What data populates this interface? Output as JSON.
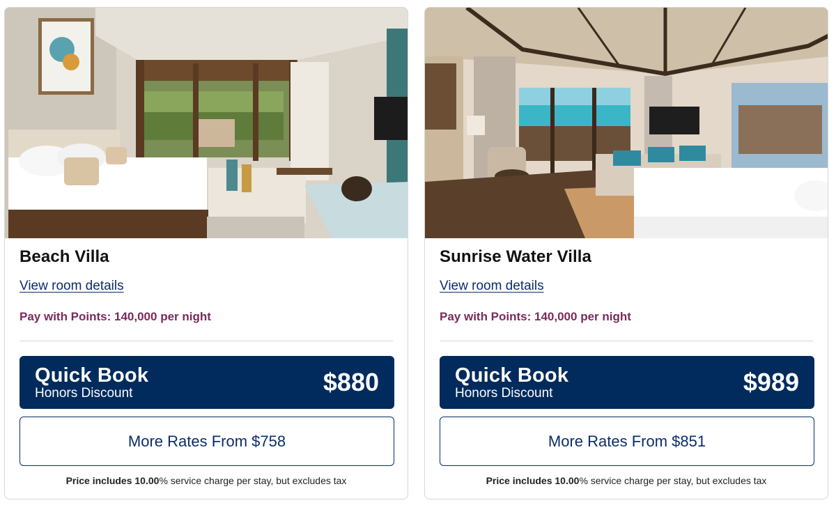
{
  "cards": [
    {
      "room_name": "Beach Villa",
      "details_link": "View room details",
      "points_text": "Pay with Points: 140,000 per night",
      "quick_book": {
        "title": "Quick Book",
        "subtitle": "Honors Discount",
        "price": "$880"
      },
      "more_rates": "More Rates From $758",
      "fine_print": {
        "bold_prefix": "Price includes",
        "bold_value": "10.00",
        "text": "% service charge per stay, but excludes tax"
      },
      "photo_icon": "beach-villa-bedroom-photo"
    },
    {
      "room_name": "Sunrise Water Villa",
      "details_link": "View room details",
      "points_text": "Pay with Points: 140,000 per night",
      "quick_book": {
        "title": "Quick Book",
        "subtitle": "Honors Discount",
        "price": "$989"
      },
      "more_rates": "More Rates From $851",
      "fine_print": {
        "bold_prefix": "Price includes",
        "bold_value": "10.00",
        "text": "% service charge per stay, but excludes tax"
      },
      "photo_icon": "water-villa-bedroom-photo"
    }
  ],
  "colors": {
    "primary_navy": "#002b5c",
    "link_blue": "#0b2d6b",
    "points_plum": "#7b2a5b"
  }
}
